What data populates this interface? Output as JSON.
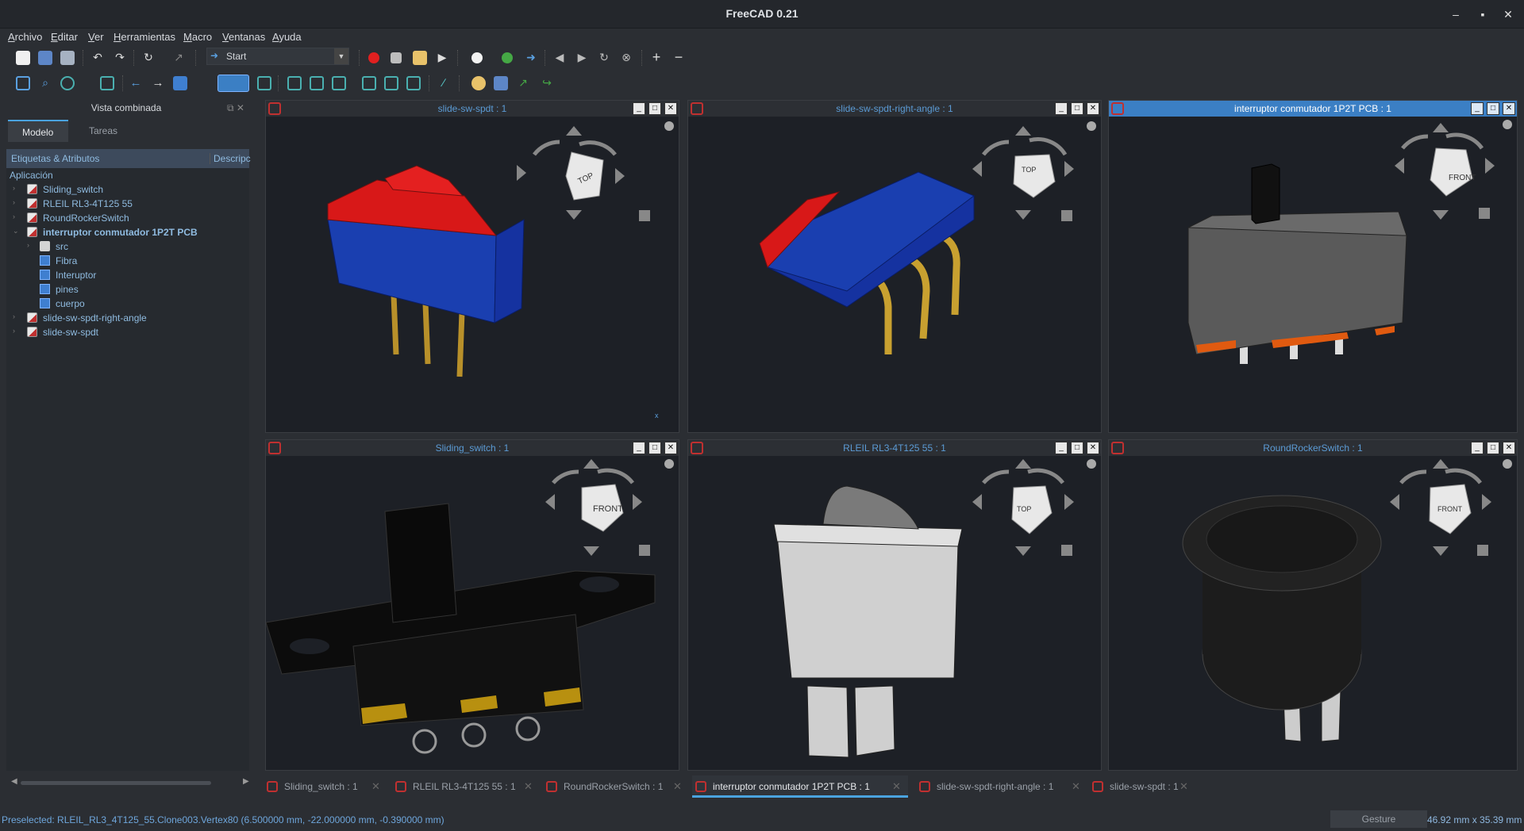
{
  "window": {
    "title": "FreeCAD 0.21"
  },
  "menu": [
    "Archivo",
    "Editar",
    "Ver",
    "Herramientas",
    "Macro",
    "Ventanas",
    "Ayuda"
  ],
  "workbench": {
    "selected": "Start"
  },
  "combo_view": {
    "title": "Vista combinada",
    "tabs": [
      "Modelo",
      "Tareas"
    ],
    "tree_columns": [
      "Etiquetas & Atributos",
      "Descripc"
    ],
    "root_label": "Aplicación",
    "items": [
      {
        "label": "Sliding_switch",
        "type": "doc",
        "level": 0
      },
      {
        "label": "RLEIL RL3-4T125 55",
        "type": "doc",
        "level": 0
      },
      {
        "label": "RoundRockerSwitch",
        "type": "doc",
        "level": 0
      },
      {
        "label": "interruptor conmutador 1P2T PCB",
        "type": "doc",
        "level": 0,
        "bold": true
      },
      {
        "label": "src",
        "type": "folder",
        "level": 1
      },
      {
        "label": "Fibra",
        "type": "part",
        "level": 1
      },
      {
        "label": "Interuptor",
        "type": "part",
        "level": 1
      },
      {
        "label": "pines",
        "type": "part",
        "level": 1
      },
      {
        "label": "cuerpo",
        "type": "part",
        "level": 1
      },
      {
        "label": "slide-sw-spdt-right-angle",
        "type": "doc",
        "level": 0
      },
      {
        "label": "slide-sw-spdt",
        "type": "doc",
        "level": 0
      }
    ]
  },
  "views": [
    {
      "title": "slide-sw-spdt : 1",
      "cube_label": "TOP"
    },
    {
      "title": "slide-sw-spdt-right-angle : 1",
      "cube_label": "TOP"
    },
    {
      "title": "interruptor conmutador 1P2T PCB  : 1",
      "cube_label": "FRONT"
    },
    {
      "title": "Sliding_switch : 1",
      "cube_label": "FRONT"
    },
    {
      "title": "RLEIL RL3-4T125 55 : 1",
      "cube_label": "TOP"
    },
    {
      "title": "RoundRockerSwitch : 1",
      "cube_label": "FRONT"
    }
  ],
  "doc_tabs": [
    "Sliding_switch : 1",
    "RLEIL RL3-4T125 55 : 1",
    "RoundRockerSwitch : 1",
    "interruptor conmutador 1P2T PCB  : 1",
    "slide-sw-spdt-right-angle : 1",
    "slide-sw-spdt : 1"
  ],
  "active_doc_tab": 3,
  "status": {
    "message": "Preselected: RLEIL_RL3_4T125_55.Clone003.Vertex80 (6.500000 mm, -22.000000 mm, -0.390000 mm)",
    "navigation": "Gesture",
    "dimensions": "46.92 mm x 35.39 mm"
  },
  "colors": {
    "accent": "#4aa3df",
    "active_title": "#3b7fc4",
    "view_bg": "#1d2026"
  }
}
